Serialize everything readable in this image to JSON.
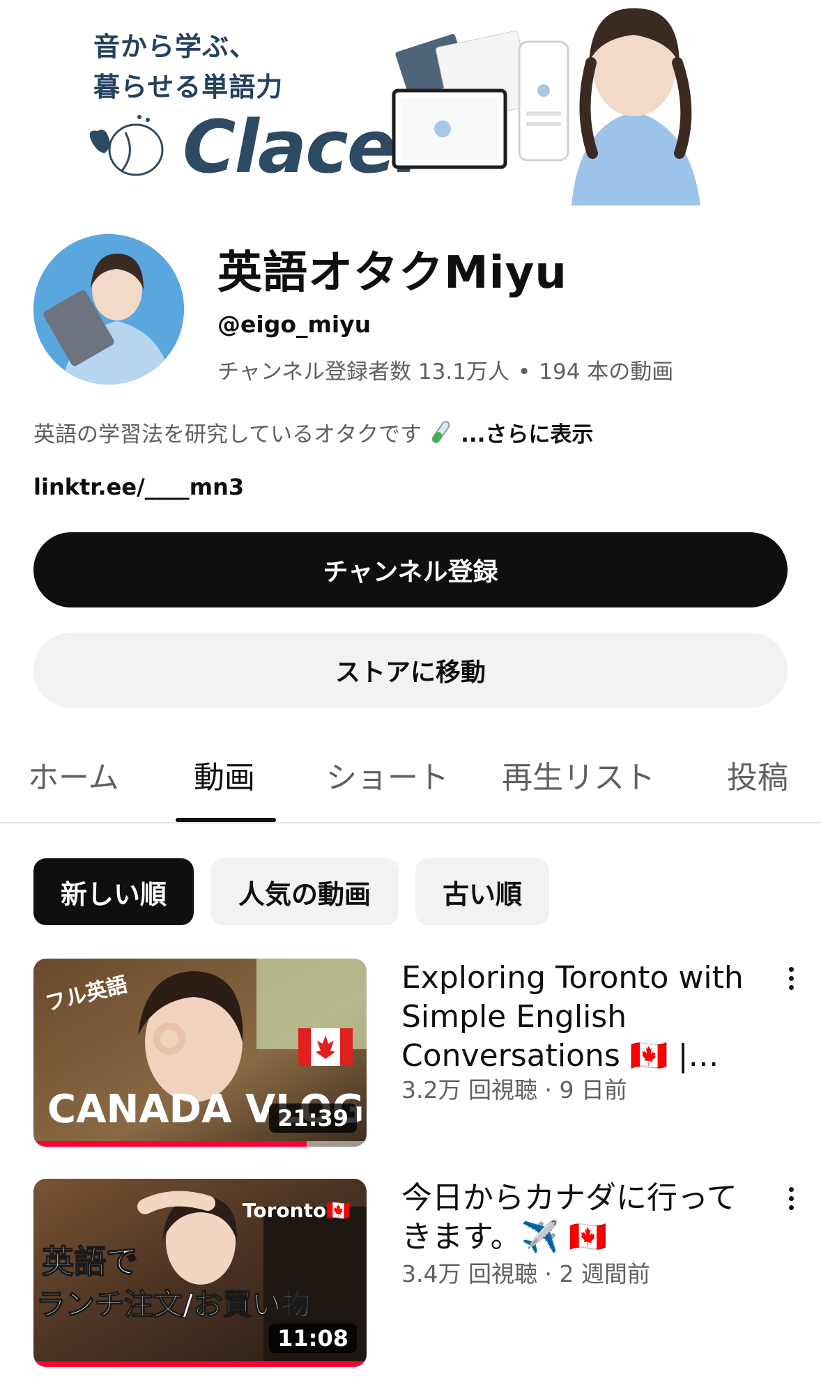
{
  "banner": {
    "tagline_line1": "音から学ぶ、",
    "tagline_line2": "暮らせる単語力",
    "logo_text": "Clacel"
  },
  "channel": {
    "name": "英語オタクMiyu",
    "handle": "@eigo_miyu",
    "subscribers": "チャンネル登録者数 13.1万人",
    "separator": "•",
    "videos": "194 本の動画",
    "description": "英語の学習法を研究しているオタクです",
    "more_label": "...さらに表示",
    "link": "linktr.ee/____mn3"
  },
  "buttons": {
    "subscribe": "チャンネル登録",
    "store": "ストアに移動"
  },
  "tabs": [
    {
      "label": "ホーム"
    },
    {
      "label": "動画"
    },
    {
      "label": "ショート"
    },
    {
      "label": "再生リスト"
    },
    {
      "label": "投稿"
    }
  ],
  "active_tab": "動画",
  "chips": [
    {
      "label": "新しい順"
    },
    {
      "label": "人気の動画"
    },
    {
      "label": "古い順"
    }
  ],
  "videos": [
    {
      "title": "Exploring Toronto with Simple English Conversations 🇨🇦 |…",
      "meta": "3.2万 回視聴 · 9 日前",
      "duration": "21:39",
      "thumb_badge": "フル英語",
      "thumb_text": "CANADA VLOG",
      "watched_fraction": 0.82
    },
    {
      "title": "今日からカナダに行ってきます。✈️ 🇨🇦",
      "meta": "3.4万 回視聴 · 2 週間前",
      "duration": "11:08",
      "thumb_badge": "Toronto🇨🇦",
      "thumb_text_line1": "英語で",
      "thumb_text_line2": "ランチ注文/お買い物",
      "watched_fraction": 1.0
    }
  ],
  "colors": {
    "accent": "#0f0f0f",
    "secondary_text": "#606060",
    "chip_bg": "#f2f2f2",
    "progress": "#ff0033",
    "banner_brand": "#2e4a63"
  }
}
